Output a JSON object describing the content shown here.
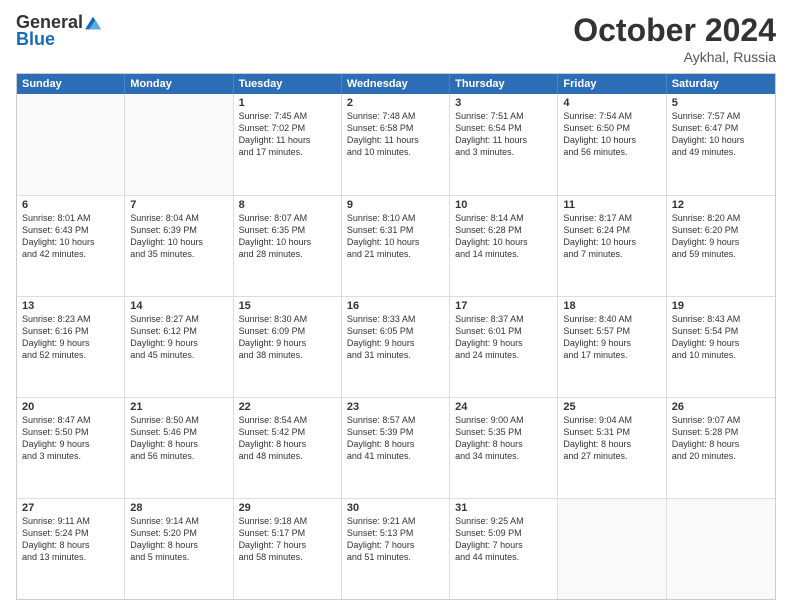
{
  "logo": {
    "general": "General",
    "blue": "Blue"
  },
  "header": {
    "month": "October 2024",
    "location": "Aykhal, Russia"
  },
  "days": [
    "Sunday",
    "Monday",
    "Tuesday",
    "Wednesday",
    "Thursday",
    "Friday",
    "Saturday"
  ],
  "weeks": [
    [
      {
        "day": "",
        "info": ""
      },
      {
        "day": "",
        "info": ""
      },
      {
        "day": "1",
        "info": "Sunrise: 7:45 AM\nSunset: 7:02 PM\nDaylight: 11 hours\nand 17 minutes."
      },
      {
        "day": "2",
        "info": "Sunrise: 7:48 AM\nSunset: 6:58 PM\nDaylight: 11 hours\nand 10 minutes."
      },
      {
        "day": "3",
        "info": "Sunrise: 7:51 AM\nSunset: 6:54 PM\nDaylight: 11 hours\nand 3 minutes."
      },
      {
        "day": "4",
        "info": "Sunrise: 7:54 AM\nSunset: 6:50 PM\nDaylight: 10 hours\nand 56 minutes."
      },
      {
        "day": "5",
        "info": "Sunrise: 7:57 AM\nSunset: 6:47 PM\nDaylight: 10 hours\nand 49 minutes."
      }
    ],
    [
      {
        "day": "6",
        "info": "Sunrise: 8:01 AM\nSunset: 6:43 PM\nDaylight: 10 hours\nand 42 minutes."
      },
      {
        "day": "7",
        "info": "Sunrise: 8:04 AM\nSunset: 6:39 PM\nDaylight: 10 hours\nand 35 minutes."
      },
      {
        "day": "8",
        "info": "Sunrise: 8:07 AM\nSunset: 6:35 PM\nDaylight: 10 hours\nand 28 minutes."
      },
      {
        "day": "9",
        "info": "Sunrise: 8:10 AM\nSunset: 6:31 PM\nDaylight: 10 hours\nand 21 minutes."
      },
      {
        "day": "10",
        "info": "Sunrise: 8:14 AM\nSunset: 6:28 PM\nDaylight: 10 hours\nand 14 minutes."
      },
      {
        "day": "11",
        "info": "Sunrise: 8:17 AM\nSunset: 6:24 PM\nDaylight: 10 hours\nand 7 minutes."
      },
      {
        "day": "12",
        "info": "Sunrise: 8:20 AM\nSunset: 6:20 PM\nDaylight: 9 hours\nand 59 minutes."
      }
    ],
    [
      {
        "day": "13",
        "info": "Sunrise: 8:23 AM\nSunset: 6:16 PM\nDaylight: 9 hours\nand 52 minutes."
      },
      {
        "day": "14",
        "info": "Sunrise: 8:27 AM\nSunset: 6:12 PM\nDaylight: 9 hours\nand 45 minutes."
      },
      {
        "day": "15",
        "info": "Sunrise: 8:30 AM\nSunset: 6:09 PM\nDaylight: 9 hours\nand 38 minutes."
      },
      {
        "day": "16",
        "info": "Sunrise: 8:33 AM\nSunset: 6:05 PM\nDaylight: 9 hours\nand 31 minutes."
      },
      {
        "day": "17",
        "info": "Sunrise: 8:37 AM\nSunset: 6:01 PM\nDaylight: 9 hours\nand 24 minutes."
      },
      {
        "day": "18",
        "info": "Sunrise: 8:40 AM\nSunset: 5:57 PM\nDaylight: 9 hours\nand 17 minutes."
      },
      {
        "day": "19",
        "info": "Sunrise: 8:43 AM\nSunset: 5:54 PM\nDaylight: 9 hours\nand 10 minutes."
      }
    ],
    [
      {
        "day": "20",
        "info": "Sunrise: 8:47 AM\nSunset: 5:50 PM\nDaylight: 9 hours\nand 3 minutes."
      },
      {
        "day": "21",
        "info": "Sunrise: 8:50 AM\nSunset: 5:46 PM\nDaylight: 8 hours\nand 56 minutes."
      },
      {
        "day": "22",
        "info": "Sunrise: 8:54 AM\nSunset: 5:42 PM\nDaylight: 8 hours\nand 48 minutes."
      },
      {
        "day": "23",
        "info": "Sunrise: 8:57 AM\nSunset: 5:39 PM\nDaylight: 8 hours\nand 41 minutes."
      },
      {
        "day": "24",
        "info": "Sunrise: 9:00 AM\nSunset: 5:35 PM\nDaylight: 8 hours\nand 34 minutes."
      },
      {
        "day": "25",
        "info": "Sunrise: 9:04 AM\nSunset: 5:31 PM\nDaylight: 8 hours\nand 27 minutes."
      },
      {
        "day": "26",
        "info": "Sunrise: 9:07 AM\nSunset: 5:28 PM\nDaylight: 8 hours\nand 20 minutes."
      }
    ],
    [
      {
        "day": "27",
        "info": "Sunrise: 9:11 AM\nSunset: 5:24 PM\nDaylight: 8 hours\nand 13 minutes."
      },
      {
        "day": "28",
        "info": "Sunrise: 9:14 AM\nSunset: 5:20 PM\nDaylight: 8 hours\nand 5 minutes."
      },
      {
        "day": "29",
        "info": "Sunrise: 9:18 AM\nSunset: 5:17 PM\nDaylight: 7 hours\nand 58 minutes."
      },
      {
        "day": "30",
        "info": "Sunrise: 9:21 AM\nSunset: 5:13 PM\nDaylight: 7 hours\nand 51 minutes."
      },
      {
        "day": "31",
        "info": "Sunrise: 9:25 AM\nSunset: 5:09 PM\nDaylight: 7 hours\nand 44 minutes."
      },
      {
        "day": "",
        "info": ""
      },
      {
        "day": "",
        "info": ""
      }
    ]
  ]
}
